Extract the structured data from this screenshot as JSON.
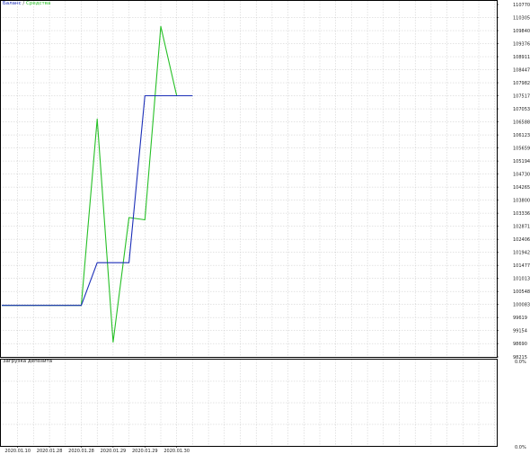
{
  "legend": {
    "balance_label": "Баланс",
    "separator": "/",
    "equity_label": "Средства"
  },
  "subpanel": {
    "title": "Загрузка депозита",
    "y_tick_labels": [
      "0.0%",
      "0.0%"
    ]
  },
  "colors": {
    "balance": "#1c2fb8",
    "equity": "#27c027",
    "grid": "#c8c8c8",
    "axis": "#000000"
  },
  "chart_data": {
    "type": "line",
    "title": "",
    "xlabel": "",
    "ylabel": "",
    "ylim": [
      98215,
      110770
    ],
    "y_ticks": [
      110770,
      110305,
      109840,
      109376,
      108911,
      108447,
      107982,
      107517,
      107053,
      106588,
      106123,
      105659,
      105194,
      104730,
      104265,
      103800,
      103336,
      102871,
      102406,
      101942,
      101477,
      101013,
      100548,
      100083,
      99619,
      99154,
      98690,
      98215
    ],
    "x_ticks": [
      {
        "label": "2020.01.10",
        "x": 1.0
      },
      {
        "label": "2020.01.28",
        "x": 3.0
      },
      {
        "label": "2020.01.28",
        "x": 5.0
      },
      {
        "label": "2020.01.29",
        "x": 7.0
      },
      {
        "label": "2020.01.29",
        "x": 9.0
      },
      {
        "label": "2020.01.30",
        "x": 11.0
      }
    ],
    "xlim": [
      0,
      31.2
    ],
    "series": [
      {
        "name": "Баланс",
        "color": "#1c2fb8",
        "x": [
          0,
          5.0,
          6.0,
          8.0,
          9.0,
          12.0
        ],
        "y": [
          100050,
          100050,
          101570,
          101570,
          107520,
          107520
        ]
      },
      {
        "name": "Средства",
        "color": "#27c027",
        "x": [
          0,
          5.0,
          6.0,
          7.0,
          8.0,
          9.0,
          10.0,
          11.0,
          12.0
        ],
        "y": [
          100050,
          100050,
          106690,
          98740,
          103180,
          103100,
          109990,
          107520,
          107520
        ]
      }
    ]
  }
}
